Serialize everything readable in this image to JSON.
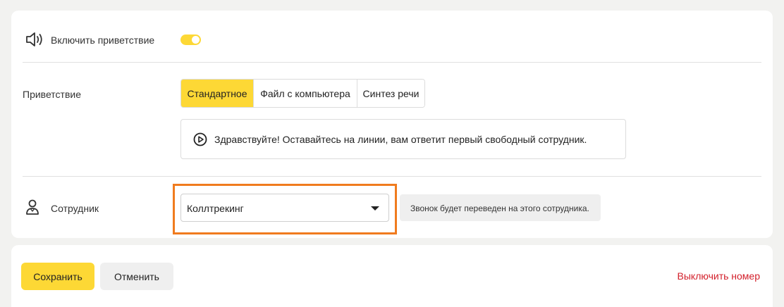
{
  "greeting_toggle": {
    "label": "Включить приветствие",
    "icon": "speaker-icon",
    "enabled": true,
    "accent_color": "#fdd835"
  },
  "greeting": {
    "label": "Приветствие",
    "tabs": [
      {
        "label": "Стандартное",
        "active": true
      },
      {
        "label": "Файл с компьютера",
        "active": false
      },
      {
        "label": "Синтез речи",
        "active": false
      }
    ],
    "message": "Здравствуйте! Оставайтесь на линии, вам ответит первый свободный сотрудник.",
    "play_icon": "play-circle-icon"
  },
  "employee": {
    "label": "Сотрудник",
    "icon": "person-icon",
    "selected": "Коллтрекинг",
    "hint": "Звонок будет переведен на этого сотрудника.",
    "highlight_color": "#f07b1e"
  },
  "footer": {
    "save_label": "Сохранить",
    "cancel_label": "Отменить",
    "disable_label": "Выключить номер",
    "danger_color": "#d3202b"
  }
}
